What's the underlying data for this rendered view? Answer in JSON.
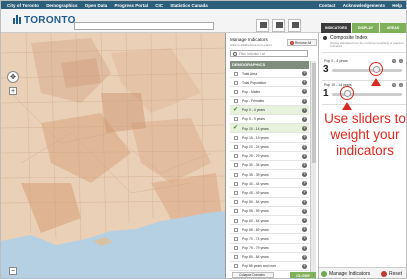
{
  "topnav": {
    "left": [
      "City of Toronto",
      "Demographics",
      "Open Data",
      "Progress Portal",
      "CIC",
      "Statistics Canada"
    ],
    "right": [
      "Contact",
      "Acknowledgements",
      "Help"
    ]
  },
  "header": {
    "logo": "TORONTO",
    "buttons": [
      {
        "label": "Save",
        "icon": "save-icon"
      },
      {
        "label": "Share",
        "icon": "share-icon"
      },
      {
        "label": "Print",
        "icon": "print-icon"
      }
    ],
    "tabs": [
      {
        "label": "INDICATORS",
        "color": "#3b3b3b"
      },
      {
        "label": "DISPLAY",
        "color": "#7fb05a"
      },
      {
        "label": "AREAS",
        "color": "#7fb05a"
      }
    ]
  },
  "manage": {
    "title": "Manage Indicators",
    "subtitle": "Click to add/remove from panel",
    "remove_all": "Remove All",
    "filter_placeholder": "Filter Indicator List",
    "category": "DEMOGRAPHICS",
    "items": [
      {
        "label": "Total Area",
        "checked": false
      },
      {
        "label": "Total Population",
        "checked": false
      },
      {
        "label": "Pop - Males",
        "checked": false
      },
      {
        "label": "Pop - Females",
        "checked": false
      },
      {
        "label": "Pop 0 - 4 years",
        "checked": true
      },
      {
        "label": "Pop 5 - 9 years",
        "checked": false
      },
      {
        "label": "Pop 10 - 14 years",
        "checked": true
      },
      {
        "label": "Pop 15 - 19 years",
        "checked": false
      },
      {
        "label": "Pop 20 - 24 years",
        "checked": false
      },
      {
        "label": "Pop 25 - 29 years",
        "checked": false
      },
      {
        "label": "Pop 30 - 34 years",
        "checked": false
      },
      {
        "label": "Pop 35 - 39 years",
        "checked": false
      },
      {
        "label": "Pop 40 - 44 years",
        "checked": false
      },
      {
        "label": "Pop 45 - 49 years",
        "checked": false
      },
      {
        "label": "Pop 50 - 54 years",
        "checked": false
      },
      {
        "label": "Pop 55 - 59 years",
        "checked": false
      },
      {
        "label": "Pop 60 - 64 years",
        "checked": false
      },
      {
        "label": "Pop 65 - 69 years",
        "checked": false
      },
      {
        "label": "Pop 70 - 74 years",
        "checked": false
      },
      {
        "label": "Pop 75 - 79 years",
        "checked": false
      },
      {
        "label": "Pop 80 - 84 years",
        "checked": false
      },
      {
        "label": "Pop 85 years and over",
        "checked": false
      }
    ],
    "collapse_label": "Collapse Domains",
    "close_label": "CLOSE"
  },
  "composite": {
    "title": "Composite Index",
    "subtitle": "Display calculated from the combined weighting of selected indicators"
  },
  "sliders": [
    {
      "label": "Pop 0 - 4 years",
      "value": "3"
    },
    {
      "label": "Pop 10 - 14 years",
      "value": "1"
    }
  ],
  "callout": "Use sliders to weight your indicators",
  "bottom": {
    "manage": "Manage Indicators",
    "reset": "Reset"
  }
}
